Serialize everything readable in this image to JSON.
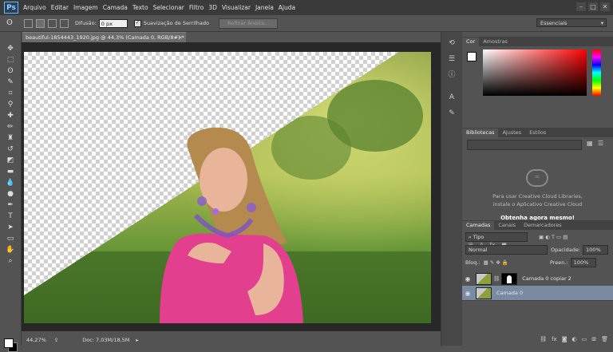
{
  "app": {
    "logo": "Ps"
  },
  "menu": [
    "Arquivo",
    "Editar",
    "Imagem",
    "Camada",
    "Texto",
    "Selecionar",
    "Filtro",
    "3D",
    "Visualizar",
    "Janela",
    "Ajuda"
  ],
  "window_buttons": [
    "–",
    "□",
    "✕"
  ],
  "options": {
    "feather_label": "Difusão:",
    "feather_value": "0 px",
    "antialias_label": "Suavização de Serrilhado",
    "refine_button": "Refinar Aresta...",
    "workspace": "Essenciais"
  },
  "document": {
    "tab_title": "beautiful-1854443_1920.jpg @ 44,3% (Camada 0, RGB/8#) *",
    "zoom": "44,27%",
    "doc_size": "Doc: 7,03M/18,5M"
  },
  "tools": [
    {
      "name": "move-tool-icon",
      "glyph": "✥"
    },
    {
      "name": "marquee-tool-icon",
      "glyph": "⬚"
    },
    {
      "name": "lasso-tool-icon",
      "glyph": "ʘ"
    },
    {
      "name": "quick-select-tool-icon",
      "glyph": "✎"
    },
    {
      "name": "crop-tool-icon",
      "glyph": "⌗"
    },
    {
      "name": "eyedropper-tool-icon",
      "glyph": "⚲"
    },
    {
      "name": "healing-brush-tool-icon",
      "glyph": "✚"
    },
    {
      "name": "brush-tool-icon",
      "glyph": "✏"
    },
    {
      "name": "clone-stamp-tool-icon",
      "glyph": "♜"
    },
    {
      "name": "history-brush-tool-icon",
      "glyph": "↺"
    },
    {
      "name": "eraser-tool-icon",
      "glyph": "◩"
    },
    {
      "name": "gradient-tool-icon",
      "glyph": "▬"
    },
    {
      "name": "blur-tool-icon",
      "glyph": "💧"
    },
    {
      "name": "dodge-tool-icon",
      "glyph": "●"
    },
    {
      "name": "pen-tool-icon",
      "glyph": "✒"
    },
    {
      "name": "type-tool-icon",
      "glyph": "T"
    },
    {
      "name": "path-select-tool-icon",
      "glyph": "➤"
    },
    {
      "name": "shape-tool-icon",
      "glyph": "▭"
    },
    {
      "name": "hand-tool-icon",
      "glyph": "✋"
    },
    {
      "name": "zoom-tool-icon",
      "glyph": "⌕"
    }
  ],
  "panels": {
    "color_tabs": [
      "Cor",
      "Amostras"
    ],
    "library_tabs": [
      "Bibliotecas",
      "Ajustes",
      "Estilos"
    ],
    "library_msg_1": "Para usar Creative Cloud Libraries,",
    "library_msg_2": "instale o Aplicativo Creative Cloud",
    "library_link": "Obtenha agora mesmo!",
    "layer_tabs": [
      "Camadas",
      "Canais",
      "Demarcadores"
    ],
    "kind_filter": "Tipo",
    "blend_mode": "Normal",
    "opacity_label": "Opacidade:",
    "opacity_value": "100%",
    "lock_label": "Bloq.:",
    "fill_label": "Preen.:",
    "fill_value": "100%",
    "layers": [
      {
        "name": "Camada 0 copiar 2",
        "selected": false,
        "has_mask": true
      },
      {
        "name": "Camada 0",
        "selected": true,
        "has_mask": false
      }
    ]
  },
  "colors": {
    "selection_blue": "#7a8aa1",
    "canvas_bg": "#282828",
    "chrome": "#535353"
  }
}
